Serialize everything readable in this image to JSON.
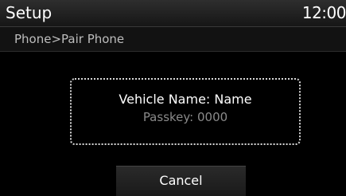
{
  "header": {
    "title": "Setup",
    "clock": "12:00"
  },
  "breadcrumb": {
    "text": "Phone>Pair Phone"
  },
  "dialog": {
    "vehicle_name": "Vehicle Name: Name",
    "passkey": "Passkey: 0000"
  },
  "actions": {
    "cancel_label": "Cancel"
  },
  "colors": {
    "background": "#000000",
    "title_bar": "#1f1f1f",
    "primary_text": "#ffffff",
    "secondary_text": "#8a8a8a",
    "breadcrumb_text": "#bdbdbd",
    "dialog_border": "#d8d8d8"
  }
}
